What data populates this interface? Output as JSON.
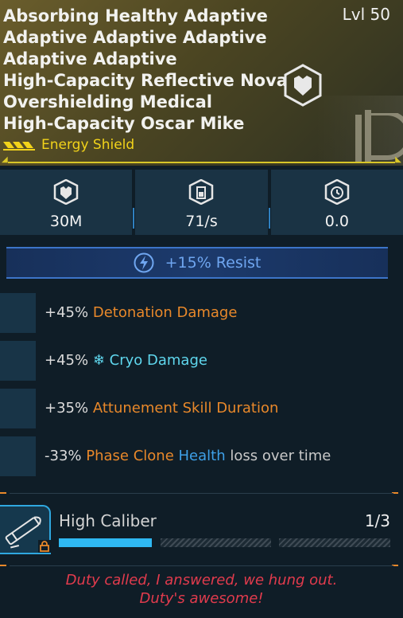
{
  "header": {
    "name_lines": [
      "Absorbing Healthy Adaptive",
      "Adaptive Adaptive Adaptive",
      "Adaptive Adaptive",
      "High-Capacity Reflective Nova",
      "Overshielding Medical",
      "High-Capacity Oscar Mike"
    ],
    "level": "Lvl 50",
    "item_type": "Energy Shield",
    "badge_icon": "shield-emblem-icon",
    "rarity_color": "#f2d31a"
  },
  "stats": [
    {
      "icon": "shield-capacity-icon",
      "value": "30M"
    },
    {
      "icon": "recharge-rate-icon",
      "value": "71/s"
    },
    {
      "icon": "recharge-delay-icon",
      "value": "0.0"
    }
  ],
  "resist": {
    "icon": "lightning-icon",
    "label": "+15% Resist"
  },
  "perks": [
    {
      "pct": "+45%",
      "parts": [
        {
          "text": "Detonation Damage",
          "color": "orange"
        }
      ]
    },
    {
      "pct": "+45%",
      "icon": "snowflake-icon",
      "parts": [
        {
          "text": "Cryo Damage",
          "color": "cyan"
        }
      ]
    },
    {
      "pct": "+35%",
      "parts": [
        {
          "text": "Attunement Skill Duration",
          "color": "orange"
        }
      ]
    },
    {
      "pct": "-33%",
      "parts": [
        {
          "text": "Phase Clone",
          "color": "orange"
        },
        {
          "text": "Health",
          "color": "blue"
        },
        {
          "text": "loss over time",
          "color": "gray"
        }
      ]
    }
  ],
  "mod": {
    "name": "High Caliber",
    "count": "1/3",
    "progress": 0.3333,
    "icon": "bullet-icon",
    "lock_icon": "lock-icon"
  },
  "flavor": {
    "line1": "Duty called, I answered, we hung out.",
    "line2": "Duty's awesome!"
  },
  "colors": {
    "accent_orange": "#e8882a",
    "accent_blue": "#2fb8f2",
    "flavor_red": "#e23b4d"
  }
}
